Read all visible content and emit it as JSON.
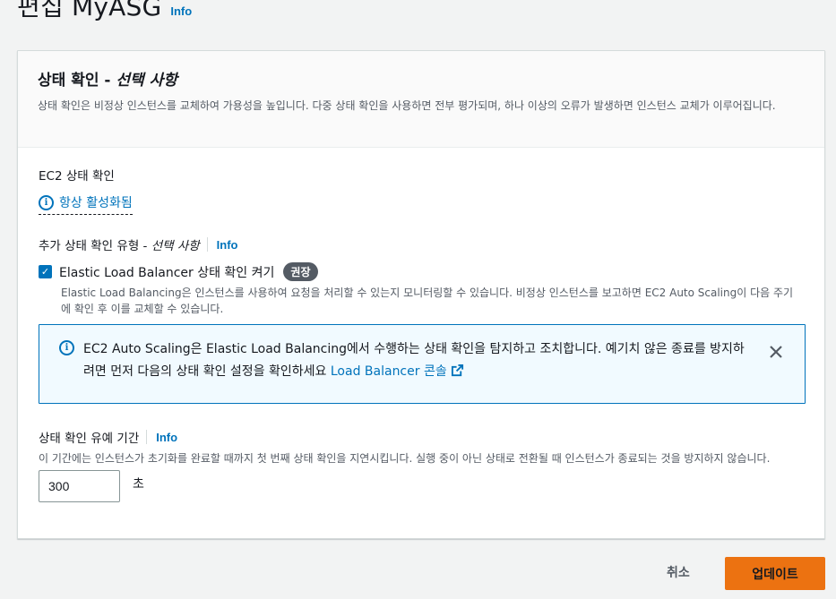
{
  "page": {
    "title": "편집 MyASG",
    "info_label": "Info"
  },
  "panel": {
    "title_main": "상태 확인 - ",
    "title_optional": "선택 사항",
    "description": "상태 확인은 비정상 인스턴스를 교체하여 가용성을 높입니다. 다중 상태 확인을 사용하면 전부 평가되며, 하나 이상의 오류가 발생하면 인스턴스 교체가 이루어집니다."
  },
  "ec2_check": {
    "label": "EC2 상태 확인",
    "status": "항상 활성화됨"
  },
  "extra_check": {
    "label_main": "추가 상태 확인 유형 - ",
    "label_optional": "선택 사항",
    "info_label": "Info",
    "elb_checkbox_label": "Elastic Load Balancer 상태 확인 켜기",
    "elb_checkbox_checked": true,
    "recommended_badge": "권장",
    "elb_description": "Elastic Load Balancing은 인스턴스를 사용하여 요청을 처리할 수 있는지 모니터링할 수 있습니다. 비정상 인스턴스를 보고하면 EC2 Auto Scaling이 다음 주기에 확인 후 이를 교체할 수 있습니다."
  },
  "alert": {
    "text": "EC2 Auto Scaling은 Elastic Load Balancing에서 수행하는 상태 확인을 탐지하고 조치합니다. 예기치 않은 종료를 방지하려면 먼저 다음의 상태 확인 설정을 확인하세요 ",
    "link_label": "Load Balancer 콘솔"
  },
  "grace_period": {
    "label": "상태 확인 유예 기간",
    "info_label": "Info",
    "description": "이 기간에는 인스턴스가 초기화를 완료할 때까지 첫 번째 상태 확인을 지연시킵니다. 실행 중이 아닌 상태로 전환될 때 인스턴스가 종료되는 것을 방지하지 않습니다.",
    "value": "300",
    "unit": "초"
  },
  "footer": {
    "cancel_label": "취소",
    "update_label": "업데이트"
  },
  "colors": {
    "link": "#0073bb",
    "primary_button": "#ec7211",
    "alert_bg": "#f1faff"
  }
}
